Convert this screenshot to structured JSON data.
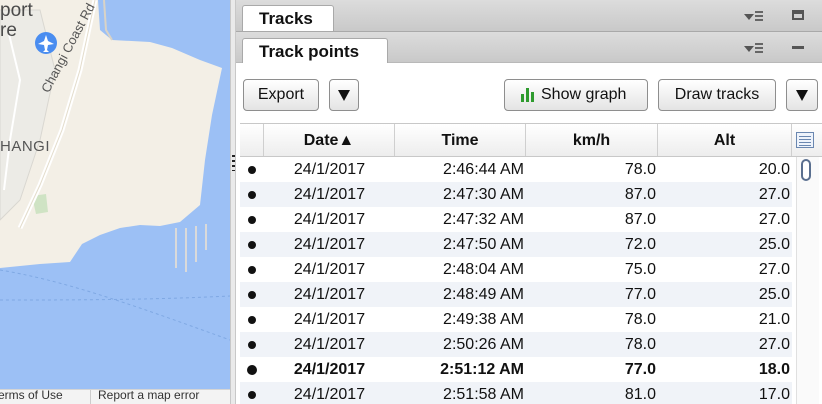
{
  "map": {
    "label_airport": "port\nre",
    "label_changi": "HANGI",
    "label_road": "Changi Coast Rd",
    "footer_terms": "Terms of Use",
    "footer_report": "Report a map error",
    "water_color": "#9cc0f5",
    "land_color": "#f3efe6"
  },
  "tabs": {
    "tracks_label": "Tracks",
    "track_points_label": "Track points"
  },
  "toolbar": {
    "export_label": "Export",
    "show_graph_label": "Show graph",
    "draw_tracks_label": "Draw tracks"
  },
  "table": {
    "columns": [
      "",
      "Date▲",
      "Time",
      "km/h",
      "Alt"
    ],
    "rows": [
      {
        "date": "24/1/2017",
        "time": "2:46:44 AM",
        "kmh": "78.0",
        "alt": "20.0",
        "selected": false
      },
      {
        "date": "24/1/2017",
        "time": "2:47:30 AM",
        "kmh": "87.0",
        "alt": "27.0",
        "selected": false
      },
      {
        "date": "24/1/2017",
        "time": "2:47:32 AM",
        "kmh": "87.0",
        "alt": "27.0",
        "selected": false
      },
      {
        "date": "24/1/2017",
        "time": "2:47:50 AM",
        "kmh": "72.0",
        "alt": "25.0",
        "selected": false
      },
      {
        "date": "24/1/2017",
        "time": "2:48:04 AM",
        "kmh": "75.0",
        "alt": "27.0",
        "selected": false
      },
      {
        "date": "24/1/2017",
        "time": "2:48:49 AM",
        "kmh": "77.0",
        "alt": "25.0",
        "selected": false
      },
      {
        "date": "24/1/2017",
        "time": "2:49:38 AM",
        "kmh": "78.0",
        "alt": "21.0",
        "selected": false
      },
      {
        "date": "24/1/2017",
        "time": "2:50:26 AM",
        "kmh": "78.0",
        "alt": "27.0",
        "selected": false
      },
      {
        "date": "24/1/2017",
        "time": "2:51:12 AM",
        "kmh": "77.0",
        "alt": "18.0",
        "selected": true
      },
      {
        "date": "24/1/2017",
        "time": "2:51:58 AM",
        "kmh": "81.0",
        "alt": "17.0",
        "selected": false
      }
    ]
  },
  "icons": {
    "airport": "airplane-icon",
    "graph": "bar-graph-icon",
    "column_picker": "column-picker-icon"
  },
  "colors": {
    "graph_green": "#2e9b2e",
    "airport_blue": "#4a8df0",
    "row_alt": "#f0f3f8"
  }
}
